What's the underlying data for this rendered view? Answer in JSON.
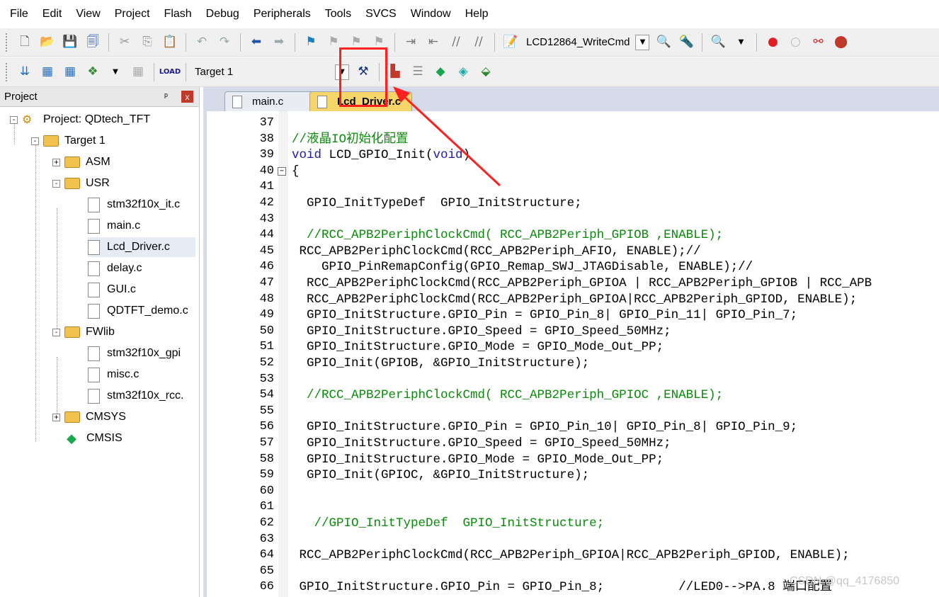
{
  "menubar": {
    "items": [
      "File",
      "Edit",
      "View",
      "Project",
      "Flash",
      "Debug",
      "Peripherals",
      "Tools",
      "SVCS",
      "Window",
      "Help"
    ]
  },
  "toolbar1": {
    "target_function": "LCD12864_WriteCmd"
  },
  "toolbar2": {
    "target": "Target 1"
  },
  "project": {
    "title": "Project",
    "pin": "ᵖ",
    "close": "x",
    "root": "Project: QDtech_TFT",
    "target": "Target 1",
    "groups": {
      "asm": "ASM",
      "usr": "USR",
      "fwlib": "FWlib",
      "cmsys": "CMSYS",
      "cmsis": "CMSIS"
    },
    "usr_files": [
      "stm32f10x_it.c",
      "main.c",
      "Lcd_Driver.c",
      "delay.c",
      "GUI.c",
      "QDTFT_demo.c"
    ],
    "fwlib_files": [
      "stm32f10x_gpi",
      "misc.c",
      "stm32f10x_rcc."
    ]
  },
  "editor": {
    "tabs": [
      "main.c",
      "Lcd_Driver.c"
    ],
    "active_tab": "Lcd_Driver.c",
    "lines": [
      {
        "n": "37",
        "text": ""
      },
      {
        "n": "38",
        "text": "//液晶IO初始化配置",
        "kind": "comment"
      },
      {
        "n": "39",
        "text": "void LCD_GPIO_Init(void)",
        "kind": "kw"
      },
      {
        "n": "40",
        "text": "{"
      },
      {
        "n": "41",
        "text": ""
      },
      {
        "n": "42",
        "text": "  GPIO_InitTypeDef  GPIO_InitStructure;"
      },
      {
        "n": "43",
        "text": ""
      },
      {
        "n": "44",
        "text": "  //RCC_APB2PeriphClockCmd( RCC_APB2Periph_GPIOB ,ENABLE);",
        "kind": "comment"
      },
      {
        "n": "45",
        "text": " RCC_APB2PeriphClockCmd(RCC_APB2Periph_AFIO, ENABLE);//"
      },
      {
        "n": "46",
        "text": "    GPIO_PinRemapConfig(GPIO_Remap_SWJ_JTAGDisable, ENABLE);//"
      },
      {
        "n": "47",
        "text": "  RCC_APB2PeriphClockCmd(RCC_APB2Periph_GPIOA | RCC_APB2Periph_GPIOB | RCC_APB"
      },
      {
        "n": "48",
        "text": "  RCC_APB2PeriphClockCmd(RCC_APB2Periph_GPIOA|RCC_APB2Periph_GPIOD, ENABLE);"
      },
      {
        "n": "49",
        "text": "  GPIO_InitStructure.GPIO_Pin = GPIO_Pin_8| GPIO_Pin_11| GPIO_Pin_7;"
      },
      {
        "n": "50",
        "text": "  GPIO_InitStructure.GPIO_Speed = GPIO_Speed_50MHz;"
      },
      {
        "n": "51",
        "text": "  GPIO_InitStructure.GPIO_Mode = GPIO_Mode_Out_PP;"
      },
      {
        "n": "52",
        "text": "  GPIO_Init(GPIOB, &GPIO_InitStructure);"
      },
      {
        "n": "53",
        "text": ""
      },
      {
        "n": "54",
        "text": "  //RCC_APB2PeriphClockCmd( RCC_APB2Periph_GPIOC ,ENABLE);",
        "kind": "comment"
      },
      {
        "n": "55",
        "text": ""
      },
      {
        "n": "56",
        "text": "  GPIO_InitStructure.GPIO_Pin = GPIO_Pin_10| GPIO_Pin_8| GPIO_Pin_9;"
      },
      {
        "n": "57",
        "text": "  GPIO_InitStructure.GPIO_Speed = GPIO_Speed_50MHz;"
      },
      {
        "n": "58",
        "text": "  GPIO_InitStructure.GPIO_Mode = GPIO_Mode_Out_PP;"
      },
      {
        "n": "59",
        "text": "  GPIO_Init(GPIOC, &GPIO_InitStructure);"
      },
      {
        "n": "60",
        "text": ""
      },
      {
        "n": "61",
        "text": ""
      },
      {
        "n": "62",
        "text": "   //GPIO_InitTypeDef  GPIO_InitStructure;",
        "kind": "comment"
      },
      {
        "n": "63",
        "text": ""
      },
      {
        "n": "64",
        "text": " RCC_APB2PeriphClockCmd(RCC_APB2Periph_GPIOA|RCC_APB2Periph_GPIOD, ENABLE);"
      },
      {
        "n": "65",
        "text": ""
      },
      {
        "n": "66",
        "text": " GPIO_InitStructure.GPIO_Pin = GPIO_Pin_8;          //LED0-->PA.8 端口配置"
      }
    ]
  },
  "watermark": "CSDN @qq_4176850",
  "colors": {
    "highlight": "#ff2020",
    "comment": "#0a8a0a",
    "keyword": "#1a1aa6",
    "active_tab": "#f6d66b"
  }
}
